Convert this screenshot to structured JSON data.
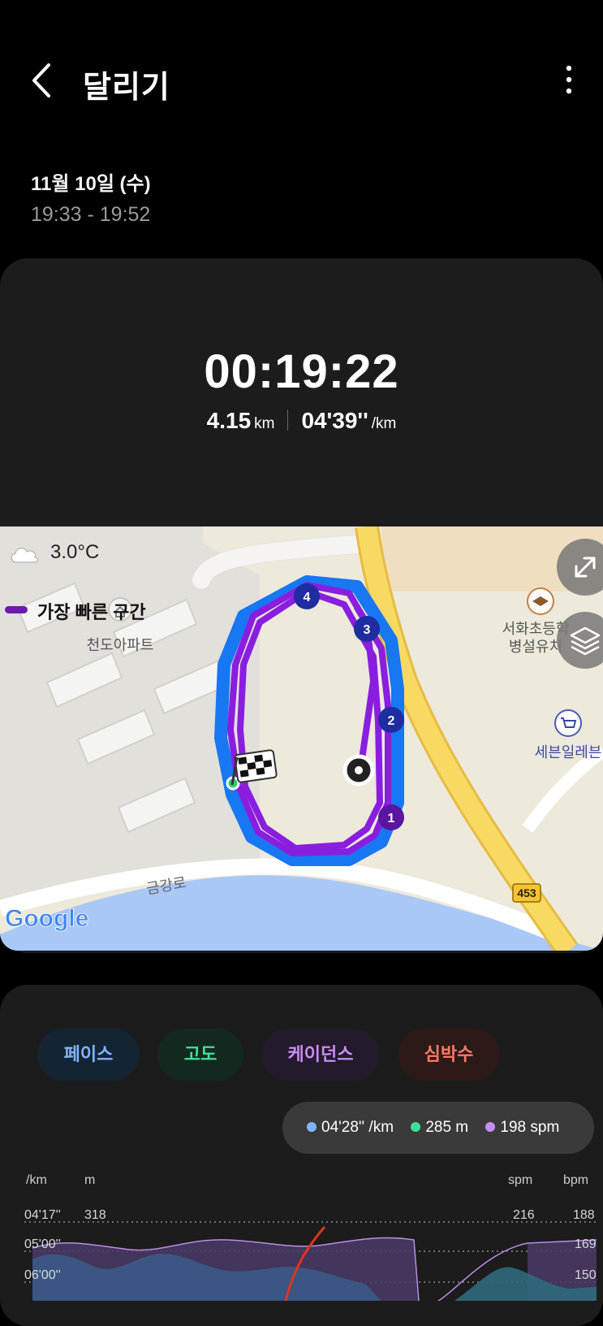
{
  "header": {
    "title": "달리기",
    "back_icon": "chevron-left-icon",
    "more_icon": "kebab-menu-icon"
  },
  "session": {
    "date": "11월 10일 (수)",
    "time_range": "19:33 - 19:52"
  },
  "summary": {
    "duration": "00:19:22",
    "distance": "4.15",
    "distance_unit": "km",
    "pace": "04'39''",
    "pace_unit": "/km"
  },
  "map": {
    "weather": "3.0°C",
    "legend_label": "가장 빠른 구간",
    "labels": {
      "apartment": "천도아파트",
      "school_line1": "서화초등학",
      "school_line2": "병설유치",
      "store": "세븐일레븐",
      "road": "금강로",
      "route_no": "453",
      "google": "Google"
    },
    "lap_markers": [
      "1",
      "2",
      "3",
      "4"
    ],
    "colors": {
      "route": "#8a1ee0",
      "route_fast": "#1877f2",
      "marker": "#1e2da0",
      "marker_purple": "#5a169e",
      "road_main": "#f5cf5a",
      "river": "#a9c8f6"
    }
  },
  "tabs": [
    {
      "label": "페이스",
      "color": "#7fb5ff",
      "bg": "#152433"
    },
    {
      "label": "고도",
      "color": "#3ee09a",
      "bg": "#14291e"
    },
    {
      "label": "케이던스",
      "color": "#c98cf5",
      "bg": "#231a2c"
    },
    {
      "label": "심박수",
      "color": "#ff7a66",
      "bg": "#2b1a18"
    }
  ],
  "readout": {
    "pace": "04'28'' /km",
    "altitude": "285 m",
    "cadence": "198 spm",
    "pace_color": "#7fb5ff",
    "alt_color": "#3ee09a",
    "cad_color": "#c98cf5"
  },
  "chart": {
    "axis_units": {
      "pace": "/km",
      "altitude": "m",
      "cadence": "spm",
      "heart": "bpm"
    },
    "pace_ticks": [
      "04'17''",
      "05'00''",
      "06'00''"
    ],
    "altitude_ticks": [
      "318"
    ],
    "cadence_ticks": [
      "216"
    ],
    "heart_ticks": [
      "188",
      "169",
      "150"
    ]
  }
}
